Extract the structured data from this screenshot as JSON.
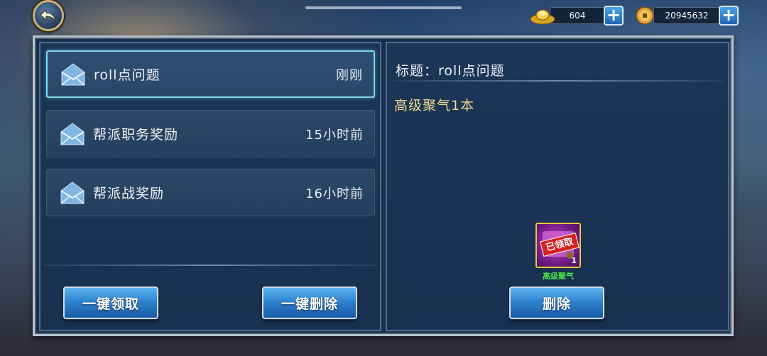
{
  "topbar": {
    "ingot_amount": "604",
    "coin_amount": "20945632"
  },
  "mail_list": [
    {
      "title": "roll点问题",
      "time": "刚刚",
      "selected": true
    },
    {
      "title": "帮派职务奖励",
      "time": "15小时前",
      "selected": false
    },
    {
      "title": "帮派战奖励",
      "time": "16小时前",
      "selected": false
    }
  ],
  "left_buttons": {
    "claim_all": "一键领取",
    "delete_all": "一键删除"
  },
  "detail": {
    "subject": "标题：roll点问题",
    "body": "高级聚气1本",
    "attachment": {
      "name": "高级聚气",
      "count": "1",
      "status_stamp": "已领取"
    },
    "delete_label": "删除"
  },
  "colors": {
    "button_blue": "#2f84cf",
    "body_text": "#f0d890",
    "item_name": "#4be04b",
    "selected_border": "#7fd7e6"
  }
}
